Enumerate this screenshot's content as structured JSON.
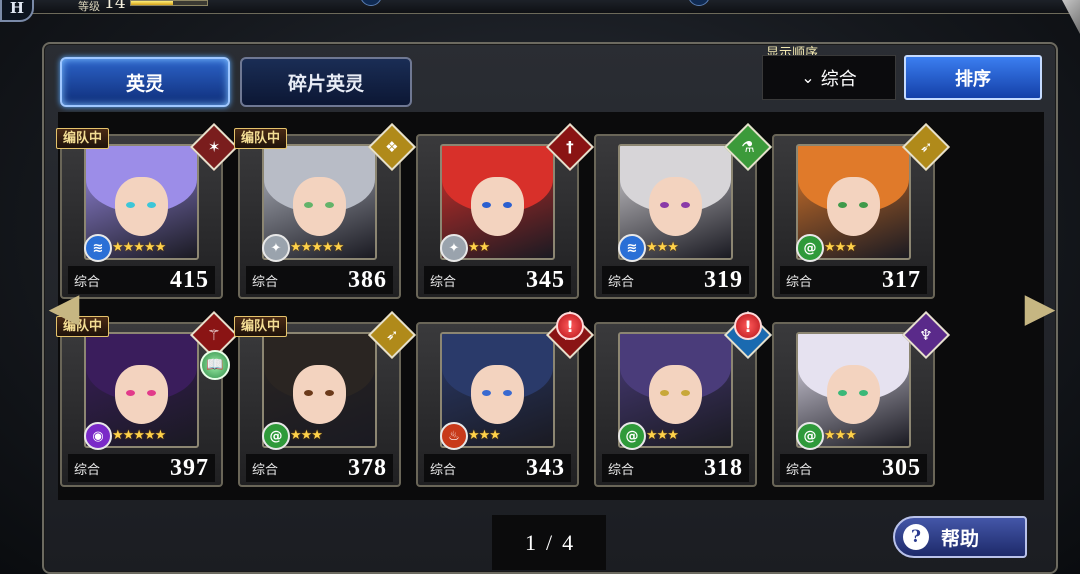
{
  "top_bar": {
    "level_label": "等级",
    "level_value": "14",
    "exp_progress": 0.55,
    "home_icon": "home-icon"
  },
  "tabs": [
    {
      "label": "英灵",
      "active": true
    },
    {
      "label": "碎片英灵",
      "active": false
    }
  ],
  "sort": {
    "caption": "显示顺序",
    "selected": "综合",
    "button_label": "排序"
  },
  "in_team_label": "编队中",
  "stat_label": "综合",
  "heroes": [
    {
      "value": "415",
      "in_team": true,
      "element": "fire-sigil-icon",
      "element_color": "#7a1d1d",
      "attr": "water-icon",
      "attr_color": "#2a6fd6",
      "stars": "★★★★★",
      "hair": "#9c8de8",
      "eyes": "#3cc6d8",
      "alert": false
    },
    {
      "value": "386",
      "in_team": true,
      "element": "wing-crest-icon",
      "element_color": "#b08a1a",
      "attr": "shuriken-icon",
      "attr_color": "#9aa3ad",
      "stars": "★★★★★",
      "hair": "#b8bcc6",
      "eyes": "#63b36a",
      "alert": false
    },
    {
      "value": "345",
      "in_team": false,
      "element": "sword-icon",
      "element_color": "#8a1414",
      "attr": "shuriken-icon",
      "attr_color": "#9aa3ad",
      "stars": "★★",
      "hair": "#d8302a",
      "eyes": "#2a5fd0",
      "alert": false
    },
    {
      "value": "319",
      "in_team": false,
      "element": "flask-icon",
      "element_color": "#3c9a3a",
      "attr": "water-icon",
      "attr_color": "#2a6fd6",
      "stars": "★★★",
      "hair": "#d7d5d8",
      "eyes": "#8a3aa8",
      "alert": false
    },
    {
      "value": "317",
      "in_team": false,
      "element": "bow-icon",
      "element_color": "#b08a1a",
      "attr": "wind-icon",
      "attr_color": "#2f9a3a",
      "stars": "★★★",
      "hair": "#e07a2a",
      "eyes": "#3f9a4a",
      "alert": false
    },
    {
      "value": "397",
      "in_team": true,
      "element": "staff-icon",
      "element_color": "#8a1414",
      "attr": "eye-icon",
      "attr_color": "#7a2ac8",
      "stars": "★★★★★",
      "hair": "#3a1d5c",
      "eyes": "#e23a8a",
      "alert": false,
      "book": true
    },
    {
      "value": "378",
      "in_team": true,
      "element": "bow-icon",
      "element_color": "#b08a1a",
      "attr": "wind-icon",
      "attr_color": "#2f9a3a",
      "stars": "★★★",
      "hair": "#2a2522",
      "eyes": "#6b3a1a",
      "alert": false
    },
    {
      "value": "343",
      "in_team": false,
      "element": "crossed-swords-icon",
      "element_color": "#8a1414",
      "attr": "flame-icon",
      "attr_color": "#c83a1a",
      "stars": "★★★",
      "hair": "#2a3a6a",
      "eyes": "#3a6ad0",
      "alert": true
    },
    {
      "value": "318",
      "in_team": false,
      "element": "beast-icon",
      "element_color": "#1a6ab0",
      "attr": "wind-icon",
      "attr_color": "#2f9a3a",
      "stars": "★★★",
      "hair": "#4a3c7a",
      "eyes": "#c8a83a",
      "alert": true
    },
    {
      "value": "305",
      "in_team": false,
      "element": "scepter-icon",
      "element_color": "#5a2a8a",
      "attr": "wind-icon",
      "attr_color": "#2f9a3a",
      "stars": "★★★",
      "hair": "#e6e2f0",
      "eyes": "#3ab878",
      "alert": false
    }
  ],
  "pager": {
    "current": "1",
    "separator": "/",
    "total": "4"
  },
  "help_label": "帮助"
}
